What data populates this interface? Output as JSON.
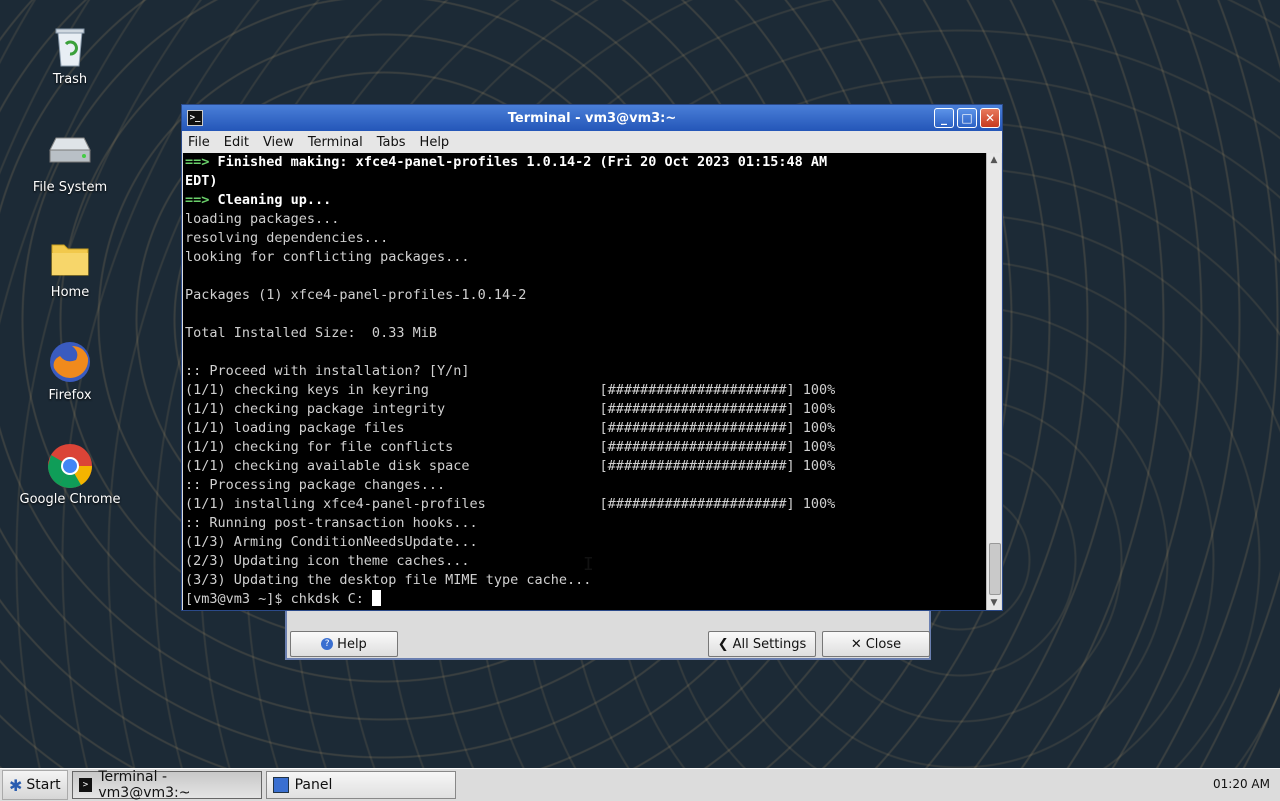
{
  "desktop": {
    "icons": [
      {
        "label": "Trash",
        "icon": "trash-icon"
      },
      {
        "label": "File System",
        "icon": "drive-icon"
      },
      {
        "label": "Home",
        "icon": "folder-icon"
      },
      {
        "label": "Firefox",
        "icon": "firefox-icon"
      },
      {
        "label": "Google Chrome",
        "icon": "chrome-icon"
      }
    ]
  },
  "terminal": {
    "title": "Terminal - vm3@vm3:~",
    "menu": [
      "File",
      "Edit",
      "View",
      "Terminal",
      "Tabs",
      "Help"
    ],
    "lines": [
      {
        "prefix": "==> ",
        "text": "Finished making: xfce4-panel-profiles 1.0.14-2 (Fri 20 Oct 2023 01:15:48 AM",
        "style": "bold"
      },
      {
        "prefix": "",
        "text": "EDT)",
        "style": "bold"
      },
      {
        "prefix": "==> ",
        "text": "Cleaning up...",
        "style": "bold"
      },
      {
        "prefix": "",
        "text": "loading packages...",
        "style": "normal"
      },
      {
        "prefix": "",
        "text": "resolving dependencies...",
        "style": "normal"
      },
      {
        "prefix": "",
        "text": "looking for conflicting packages...",
        "style": "normal"
      },
      {
        "prefix": "",
        "text": "",
        "style": "normal"
      },
      {
        "prefix": "",
        "text": "Packages (1) xfce4-panel-profiles-1.0.14-2",
        "style": "normal"
      },
      {
        "prefix": "",
        "text": "",
        "style": "normal"
      },
      {
        "prefix": "",
        "text": "Total Installed Size:  0.33 MiB",
        "style": "normal"
      },
      {
        "prefix": "",
        "text": "",
        "style": "normal"
      },
      {
        "prefix": "",
        "text": ":: Proceed with installation? [Y/n]",
        "style": "normal"
      },
      {
        "prefix": "",
        "text": "(1/1) checking keys in keyring                     [######################] 100%",
        "style": "normal"
      },
      {
        "prefix": "",
        "text": "(1/1) checking package integrity                   [######################] 100%",
        "style": "normal"
      },
      {
        "prefix": "",
        "text": "(1/1) loading package files                        [######################] 100%",
        "style": "normal"
      },
      {
        "prefix": "",
        "text": "(1/1) checking for file conflicts                  [######################] 100%",
        "style": "normal"
      },
      {
        "prefix": "",
        "text": "(1/1) checking available disk space                [######################] 100%",
        "style": "normal"
      },
      {
        "prefix": "",
        "text": ":: Processing package changes...",
        "style": "normal"
      },
      {
        "prefix": "",
        "text": "(1/1) installing xfce4-panel-profiles              [######################] 100%",
        "style": "normal"
      },
      {
        "prefix": "",
        "text": ":: Running post-transaction hooks...",
        "style": "normal"
      },
      {
        "prefix": "",
        "text": "(1/3) Arming ConditionNeedsUpdate...",
        "style": "normal"
      },
      {
        "prefix": "",
        "text": "(2/3) Updating icon theme caches...",
        "style": "normal"
      },
      {
        "prefix": "",
        "text": "(3/3) Updating the desktop file MIME type cache...",
        "style": "normal"
      }
    ],
    "prompt": "[vm3@vm3 ~]$ ",
    "command": "chkdsk C: "
  },
  "panel_dialog": {
    "help_label": "Help",
    "all_settings_label": "All Settings",
    "close_label": "Close"
  },
  "taskbar": {
    "start_label": "Start",
    "tasks": [
      {
        "label": "Terminal - vm3@vm3:~",
        "icon": "terminal-icon",
        "active": true
      },
      {
        "label": "Panel",
        "icon": "panel-icon",
        "active": false
      }
    ],
    "clock": "01:20 AM"
  }
}
